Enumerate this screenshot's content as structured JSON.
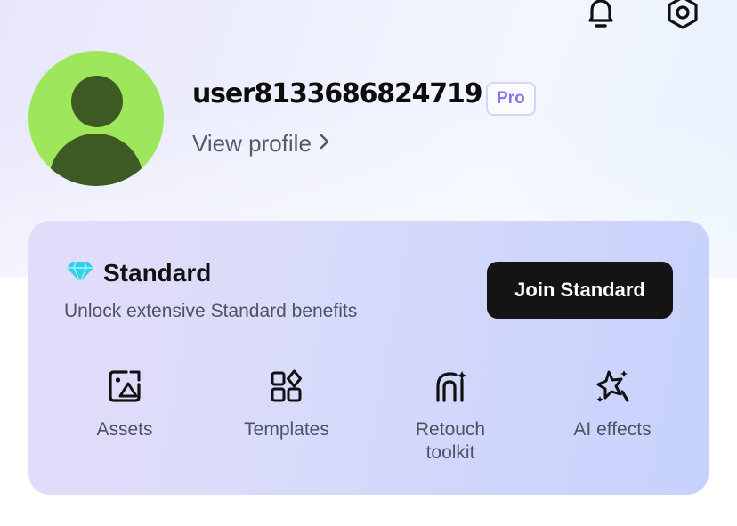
{
  "header": {
    "notification_icon": "bell-icon",
    "settings_icon": "settings-hex-icon"
  },
  "profile": {
    "username": "user8133686824719",
    "badge": "Pro",
    "view_profile": "View profile",
    "avatar_colors": {
      "background": "#9ee65c",
      "figure": "#3d5a22"
    }
  },
  "plan_card": {
    "icon": "diamond-icon",
    "title": "Standard",
    "subtitle": "Unlock extensive Standard benefits",
    "cta": "Join Standard",
    "features": [
      {
        "label": "Assets",
        "icon": "assets-icon"
      },
      {
        "label": "Templates",
        "icon": "templates-icon"
      },
      {
        "label": "Retouch toolkit",
        "icon": "retouch-icon"
      },
      {
        "label": "AI effects",
        "icon": "ai-effects-icon"
      }
    ]
  },
  "colors": {
    "accent_pro": "#8a76e8",
    "diamond": "#2fd0e8",
    "button_bg": "#141414"
  }
}
